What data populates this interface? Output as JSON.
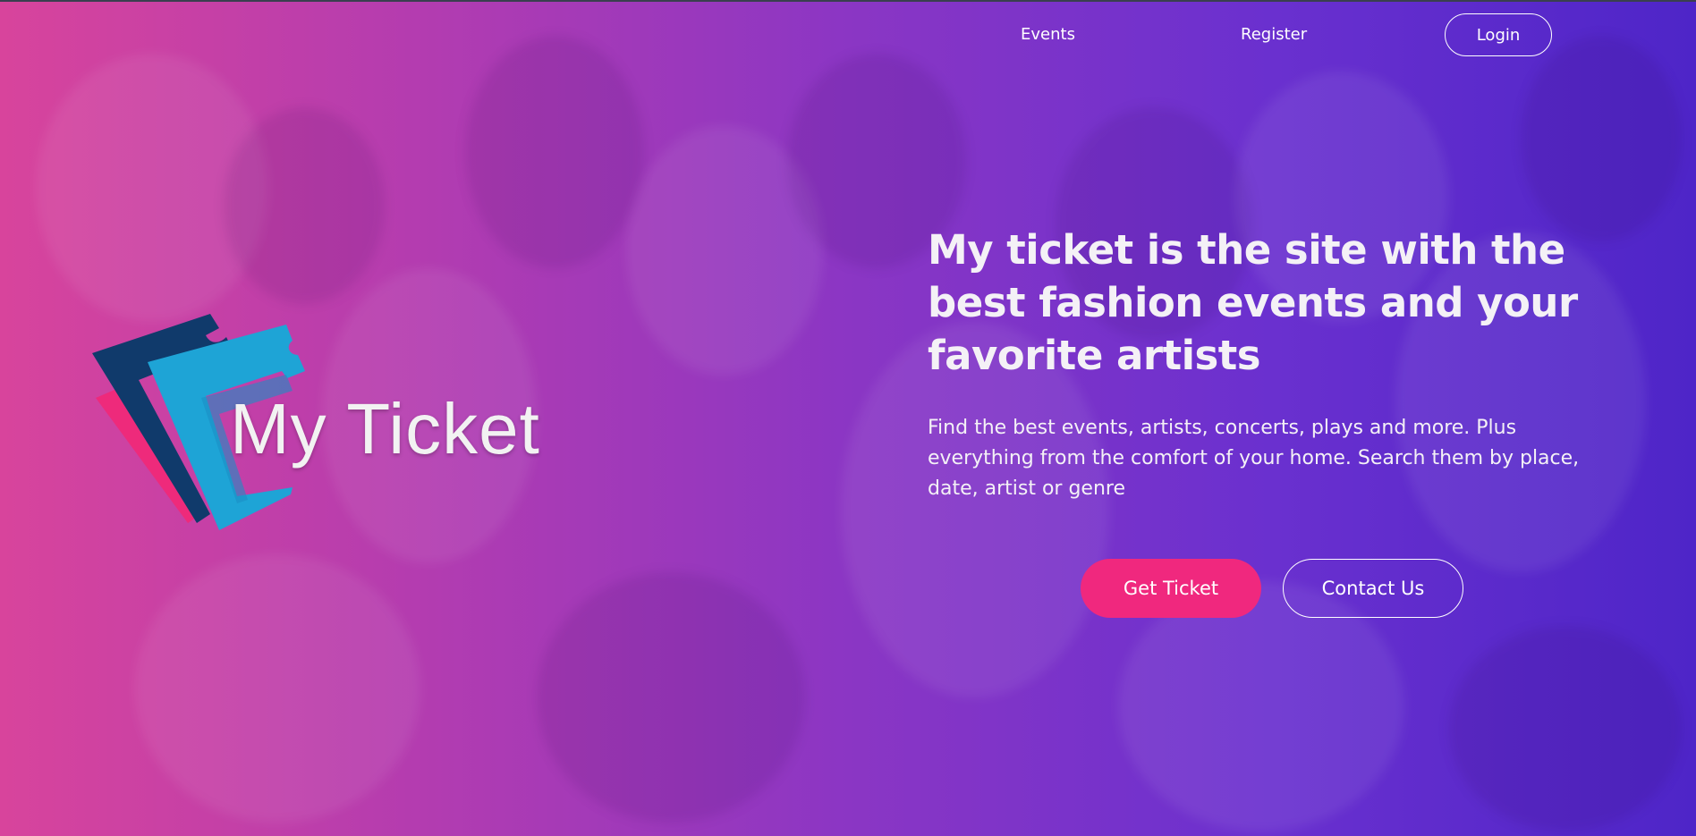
{
  "nav": {
    "events_label": "Events",
    "register_label": "Register",
    "login_label": "Login"
  },
  "logo": {
    "text": "My Ticket",
    "icon": "ticket-stack-icon",
    "colors": [
      "#103a6b",
      "#1ea4d6",
      "#ee2a7b"
    ]
  },
  "hero": {
    "title": "My ticket is the site with the best fashion events and your favorite artists",
    "description": "Find the best events, artists, concerts, plays and more. Plus everything from the comfort of your home. Search them by place, date, artist or genre",
    "primary_button": "Get Ticket",
    "secondary_button": "Contact Us"
  },
  "colors": {
    "accent": "#f0287e",
    "gradient_start": "#d8449c",
    "gradient_end": "#4e25c8"
  }
}
